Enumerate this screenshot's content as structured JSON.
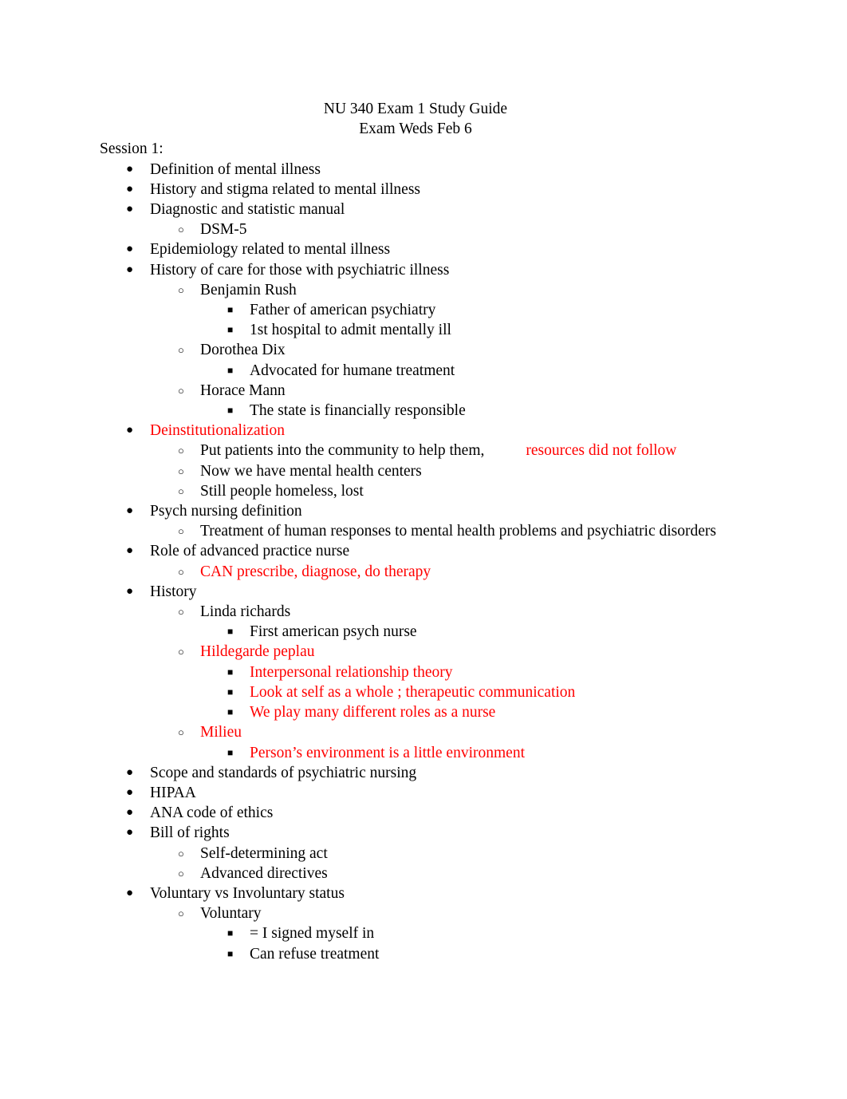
{
  "document": {
    "title_lines": [
      "NU 340 Exam 1 Study Guide",
      "Exam Weds Feb 6"
    ],
    "section_heading": "Session 1:",
    "bullets": {
      "level1": "●",
      "level2": "○",
      "level3": "■"
    },
    "colors": {
      "text": "#000000",
      "highlight": "#ff0000",
      "background": "#ffffff"
    },
    "outline": [
      {
        "level": 1,
        "text": "Definition of mental illness",
        "color": "black"
      },
      {
        "level": 1,
        "text": "History and stigma related to mental illness",
        "color": "black"
      },
      {
        "level": 1,
        "text": "Diagnostic and statistic manual",
        "color": "black"
      },
      {
        "level": 2,
        "text": "DSM-5",
        "color": "black"
      },
      {
        "level": 1,
        "text": "Epidemiology related to mental illness",
        "color": "black"
      },
      {
        "level": 1,
        "text": "History of care for those with psychiatric illness",
        "color": "black"
      },
      {
        "level": 2,
        "text": "Benjamin Rush",
        "color": "black"
      },
      {
        "level": 3,
        "text": "Father of american psychiatry",
        "color": "black"
      },
      {
        "level": 3,
        "text": "1st hospital to admit mentally ill",
        "color": "black"
      },
      {
        "level": 2,
        "text": "Dorothea Dix",
        "color": "black"
      },
      {
        "level": 3,
        "text": "Advocated for humane treatment",
        "color": "black"
      },
      {
        "level": 2,
        "text": "Horace Mann",
        "color": "black"
      },
      {
        "level": 3,
        "text": "The state is financially responsible",
        "color": "black"
      },
      {
        "level": 1,
        "text": "Deinstitutionalization",
        "color": "red"
      },
      {
        "level": 2,
        "text": "Put patients into the community to help them,",
        "color": "black",
        "trailing_gap": true,
        "trailing_text": "resources did not follow",
        "trailing_color": "red"
      },
      {
        "level": 2,
        "text": "Now we have mental health centers",
        "color": "black"
      },
      {
        "level": 2,
        "text": "Still people homeless, lost",
        "color": "black"
      },
      {
        "level": 1,
        "text": "Psych nursing definition",
        "color": "black"
      },
      {
        "level": 2,
        "text": "Treatment of human responses to mental health problems and psychiatric disorders",
        "color": "black"
      },
      {
        "level": 1,
        "text": "Role of advanced practice nurse",
        "color": "black"
      },
      {
        "level": 2,
        "text": "CAN prescribe, diagnose, do therapy",
        "color": "red"
      },
      {
        "level": 1,
        "text": "History",
        "color": "black"
      },
      {
        "level": 2,
        "text": "Linda richards",
        "color": "black"
      },
      {
        "level": 3,
        "text": "First american psych nurse",
        "color": "black"
      },
      {
        "level": 2,
        "text": "Hildegarde peplau",
        "color": "red"
      },
      {
        "level": 3,
        "text": "Interpersonal relationship theory",
        "color": "red"
      },
      {
        "level": 3,
        "text": "Look at self as a whole ; therapeutic communication",
        "color": "red"
      },
      {
        "level": 3,
        "text": "We play many different roles as a nurse",
        "color": "red"
      },
      {
        "level": 2,
        "text": "Milieu",
        "color": "red"
      },
      {
        "level": 3,
        "text": "Person’s environment is a little environment",
        "color": "red"
      },
      {
        "level": 1,
        "text": "Scope and standards of psychiatric nursing",
        "color": "black"
      },
      {
        "level": 1,
        "text": "HIPAA",
        "color": "black"
      },
      {
        "level": 1,
        "text": "ANA code of ethics",
        "color": "black"
      },
      {
        "level": 1,
        "text": "Bill of rights",
        "color": "black"
      },
      {
        "level": 2,
        "text": "Self-determining act",
        "color": "black"
      },
      {
        "level": 2,
        "text": "Advanced directives",
        "color": "black"
      },
      {
        "level": 1,
        "text": "Voluntary vs Involuntary status",
        "color": "black"
      },
      {
        "level": 2,
        "text": "Voluntary",
        "color": "black"
      },
      {
        "level": 3,
        "text": "= I signed myself in",
        "color": "black"
      },
      {
        "level": 3,
        "text": "Can refuse treatment",
        "color": "black"
      }
    ]
  }
}
